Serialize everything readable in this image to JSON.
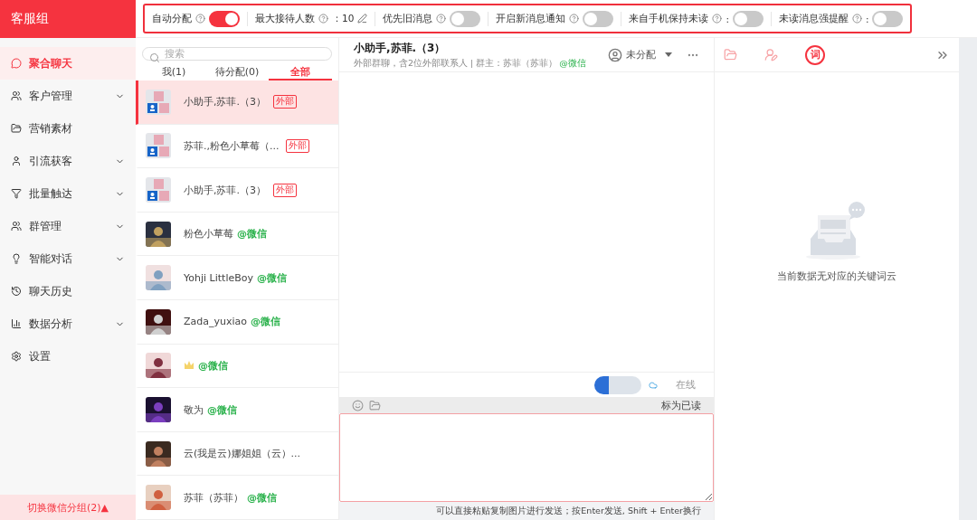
{
  "sidebar": {
    "title": "客服组",
    "items": [
      {
        "label": "聚合聊天",
        "selected": true,
        "expandable": false
      },
      {
        "label": "客户管理",
        "selected": false,
        "expandable": true
      },
      {
        "label": "营销素材",
        "selected": false,
        "expandable": false
      },
      {
        "label": "引流获客",
        "selected": false,
        "expandable": true
      },
      {
        "label": "批量触达",
        "selected": false,
        "expandable": true
      },
      {
        "label": "群管理",
        "selected": false,
        "expandable": true
      },
      {
        "label": "智能对话",
        "selected": false,
        "expandable": true
      },
      {
        "label": "聊天历史",
        "selected": false,
        "expandable": false
      },
      {
        "label": "数据分析",
        "selected": false,
        "expandable": true
      },
      {
        "label": "设置",
        "selected": false,
        "expandable": false
      }
    ],
    "footer": "切换微信分组(2)▲"
  },
  "settings_bar": [
    {
      "kind": "toggle",
      "label": "自动分配",
      "on": true
    },
    {
      "kind": "number",
      "label": "最大接待人数",
      "value": "：10"
    },
    {
      "kind": "toggle",
      "label": "优先旧消息",
      "on": false
    },
    {
      "kind": "toggle",
      "label": "开启新消息通知",
      "on": false
    },
    {
      "kind": "toggle",
      "label": "来自手机保持未读",
      "suffix": ":",
      "on": false
    },
    {
      "kind": "toggle",
      "label": "未读消息强提醒",
      "suffix": ":",
      "on": false
    }
  ],
  "contacts": {
    "search": {
      "placeholder": "搜索"
    },
    "tabs": [
      {
        "label": "我(1)",
        "selected": false
      },
      {
        "label": "待分配(0)",
        "selected": false
      },
      {
        "label": "全部",
        "selected": true
      }
    ],
    "rows": [
      {
        "kind": "group",
        "name": "小助手,苏菲.（3）",
        "tag": "外部",
        "selected": true
      },
      {
        "kind": "group",
        "name": "苏菲.,粉色小草莓（...",
        "tag": "外部",
        "selected": false
      },
      {
        "kind": "group",
        "name": "小助手,苏菲.（3）",
        "tag": "外部",
        "selected": false
      },
      {
        "kind": "person",
        "name": "粉色小草莓",
        "channel": "@微信",
        "selected": false
      },
      {
        "kind": "person",
        "name": "Yohji LittleBoy",
        "channel": "@微信",
        "selected": false
      },
      {
        "kind": "person",
        "name": "Zada_yuxiao",
        "channel": "@微信",
        "selected": false
      },
      {
        "kind": "crown",
        "channel": "@微信",
        "selected": false
      },
      {
        "kind": "person",
        "name": "敬为",
        "channel": "@微信",
        "selected": false
      },
      {
        "kind": "person",
        "name": "云(我是云)娜姐姐（云）...",
        "selected": false
      },
      {
        "kind": "person",
        "name": "苏菲（苏菲）",
        "channel": "@微信",
        "selected": false
      }
    ]
  },
  "chat": {
    "title": "小助手,苏菲.（3）",
    "subtitle": "外部群聊，含2位外部联系人 | 群主：苏菲（苏菲）",
    "channel": "@微信",
    "assignee": "未分配",
    "status": "在线",
    "mark_read": "标为已读",
    "hint": "可以直接粘贴复制图片进行发送；按Enter发送, Shift + Enter换行"
  },
  "right_panel": {
    "tabs": [
      {
        "kind": "folder",
        "selected": false
      },
      {
        "kind": "contact",
        "selected": false
      },
      {
        "kind": "keyword",
        "glyph": "词",
        "selected": true
      }
    ],
    "empty_text": "当前数据无对应的关键词云"
  }
}
